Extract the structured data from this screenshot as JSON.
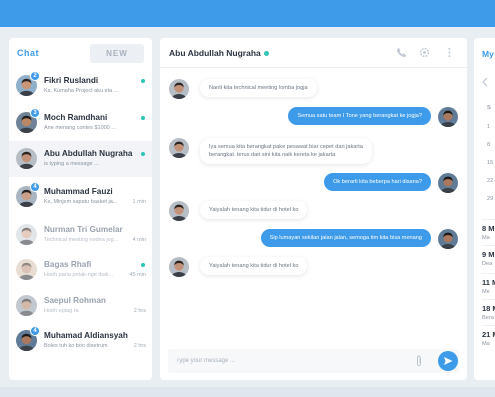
{
  "sidebar": {
    "tab_chat": "Chat",
    "new_label": "NEW",
    "contacts": [
      {
        "name": "Fikri Ruslandi",
        "preview": "Ks, Kumaha Project aku eta ...",
        "time": "",
        "badge": "2",
        "online": true
      },
      {
        "name": "Moch Ramdhani",
        "preview": "Ane menang contes $1000 ...",
        "time": "",
        "badge": "3",
        "online": true
      },
      {
        "name": "Abu Abdullah Nugraha",
        "preview": "is typing a message ...",
        "time": "",
        "badge": "",
        "online": true
      },
      {
        "name": "Muhammad Fauzi",
        "preview": "Ks, Minjem sapatu basket ja...",
        "time": "1 min",
        "badge": "4",
        "online": false
      },
      {
        "name": "Nurman Tri Gumelar",
        "preview": "Technical meeting nodea jog...",
        "time": "4 min",
        "badge": "",
        "online": false
      },
      {
        "name": "Bagas Rhafi",
        "preview": "Hoeh paria petak-nge ibak...",
        "time": "45 min",
        "badge": "",
        "online": true
      },
      {
        "name": "Saepul Rohman",
        "preview": "Hoeh epiag ra",
        "time": "2 hrs",
        "badge": "",
        "online": false
      },
      {
        "name": "Muhamad Aldiansyah",
        "preview": "Boles tuh ko boo disetrum",
        "time": "2 hrs",
        "badge": "4",
        "online": false
      }
    ]
  },
  "chat": {
    "contact_name": "Abu Abdullah Nugraha",
    "messages": [
      {
        "dir": "in",
        "lines": [
          "Nanti kita technical meeting lomba jogja"
        ]
      },
      {
        "dir": "out",
        "lines": [
          "Semua satu team I Tone yang berangkat ke jogja?"
        ]
      },
      {
        "dir": "in",
        "lines": [
          "Iya semua kita berangkat pake pesawat biar cepet dari jakarta",
          "berangkat. terus dari sini kita naik kereta ke jakarta"
        ]
      },
      {
        "dir": "out",
        "lines": [
          "Ok berarti kita beberpa hari disana?"
        ]
      },
      {
        "dir": "in",
        "lines": [
          "Yaiyalah tenang kita tidur di hotel ko"
        ]
      },
      {
        "dir": "out",
        "lines": [
          "Sip lumayan sekilan jalan jalan, semoga tim kita bisa menang"
        ]
      },
      {
        "dir": "in",
        "lines": [
          "Yaiyalah tenang kita tidur di hotel ko"
        ]
      }
    ],
    "composer_placeholder": "Type your message ..."
  },
  "right": {
    "title": "My",
    "cal_header": "S",
    "cal_days": [
      "1",
      "8",
      "15",
      "22",
      "29"
    ],
    "events": [
      {
        "date": "8 M",
        "label": "Ma"
      },
      {
        "date": "9 M",
        "label": "Dea"
      },
      {
        "date": "11 M",
        "label": "Me"
      },
      {
        "date": "18 M",
        "label": "Bera"
      },
      {
        "date": "21 M",
        "label": "Ma"
      }
    ]
  },
  "colors": {
    "accent": "#3d9be9",
    "online": "#2ec4b6",
    "background": "#e9eef3"
  },
  "icons": [
    "phone-icon",
    "settings-icon",
    "more-vertical-icon",
    "paperclip-icon",
    "send-icon",
    "chevron-left-icon"
  ]
}
